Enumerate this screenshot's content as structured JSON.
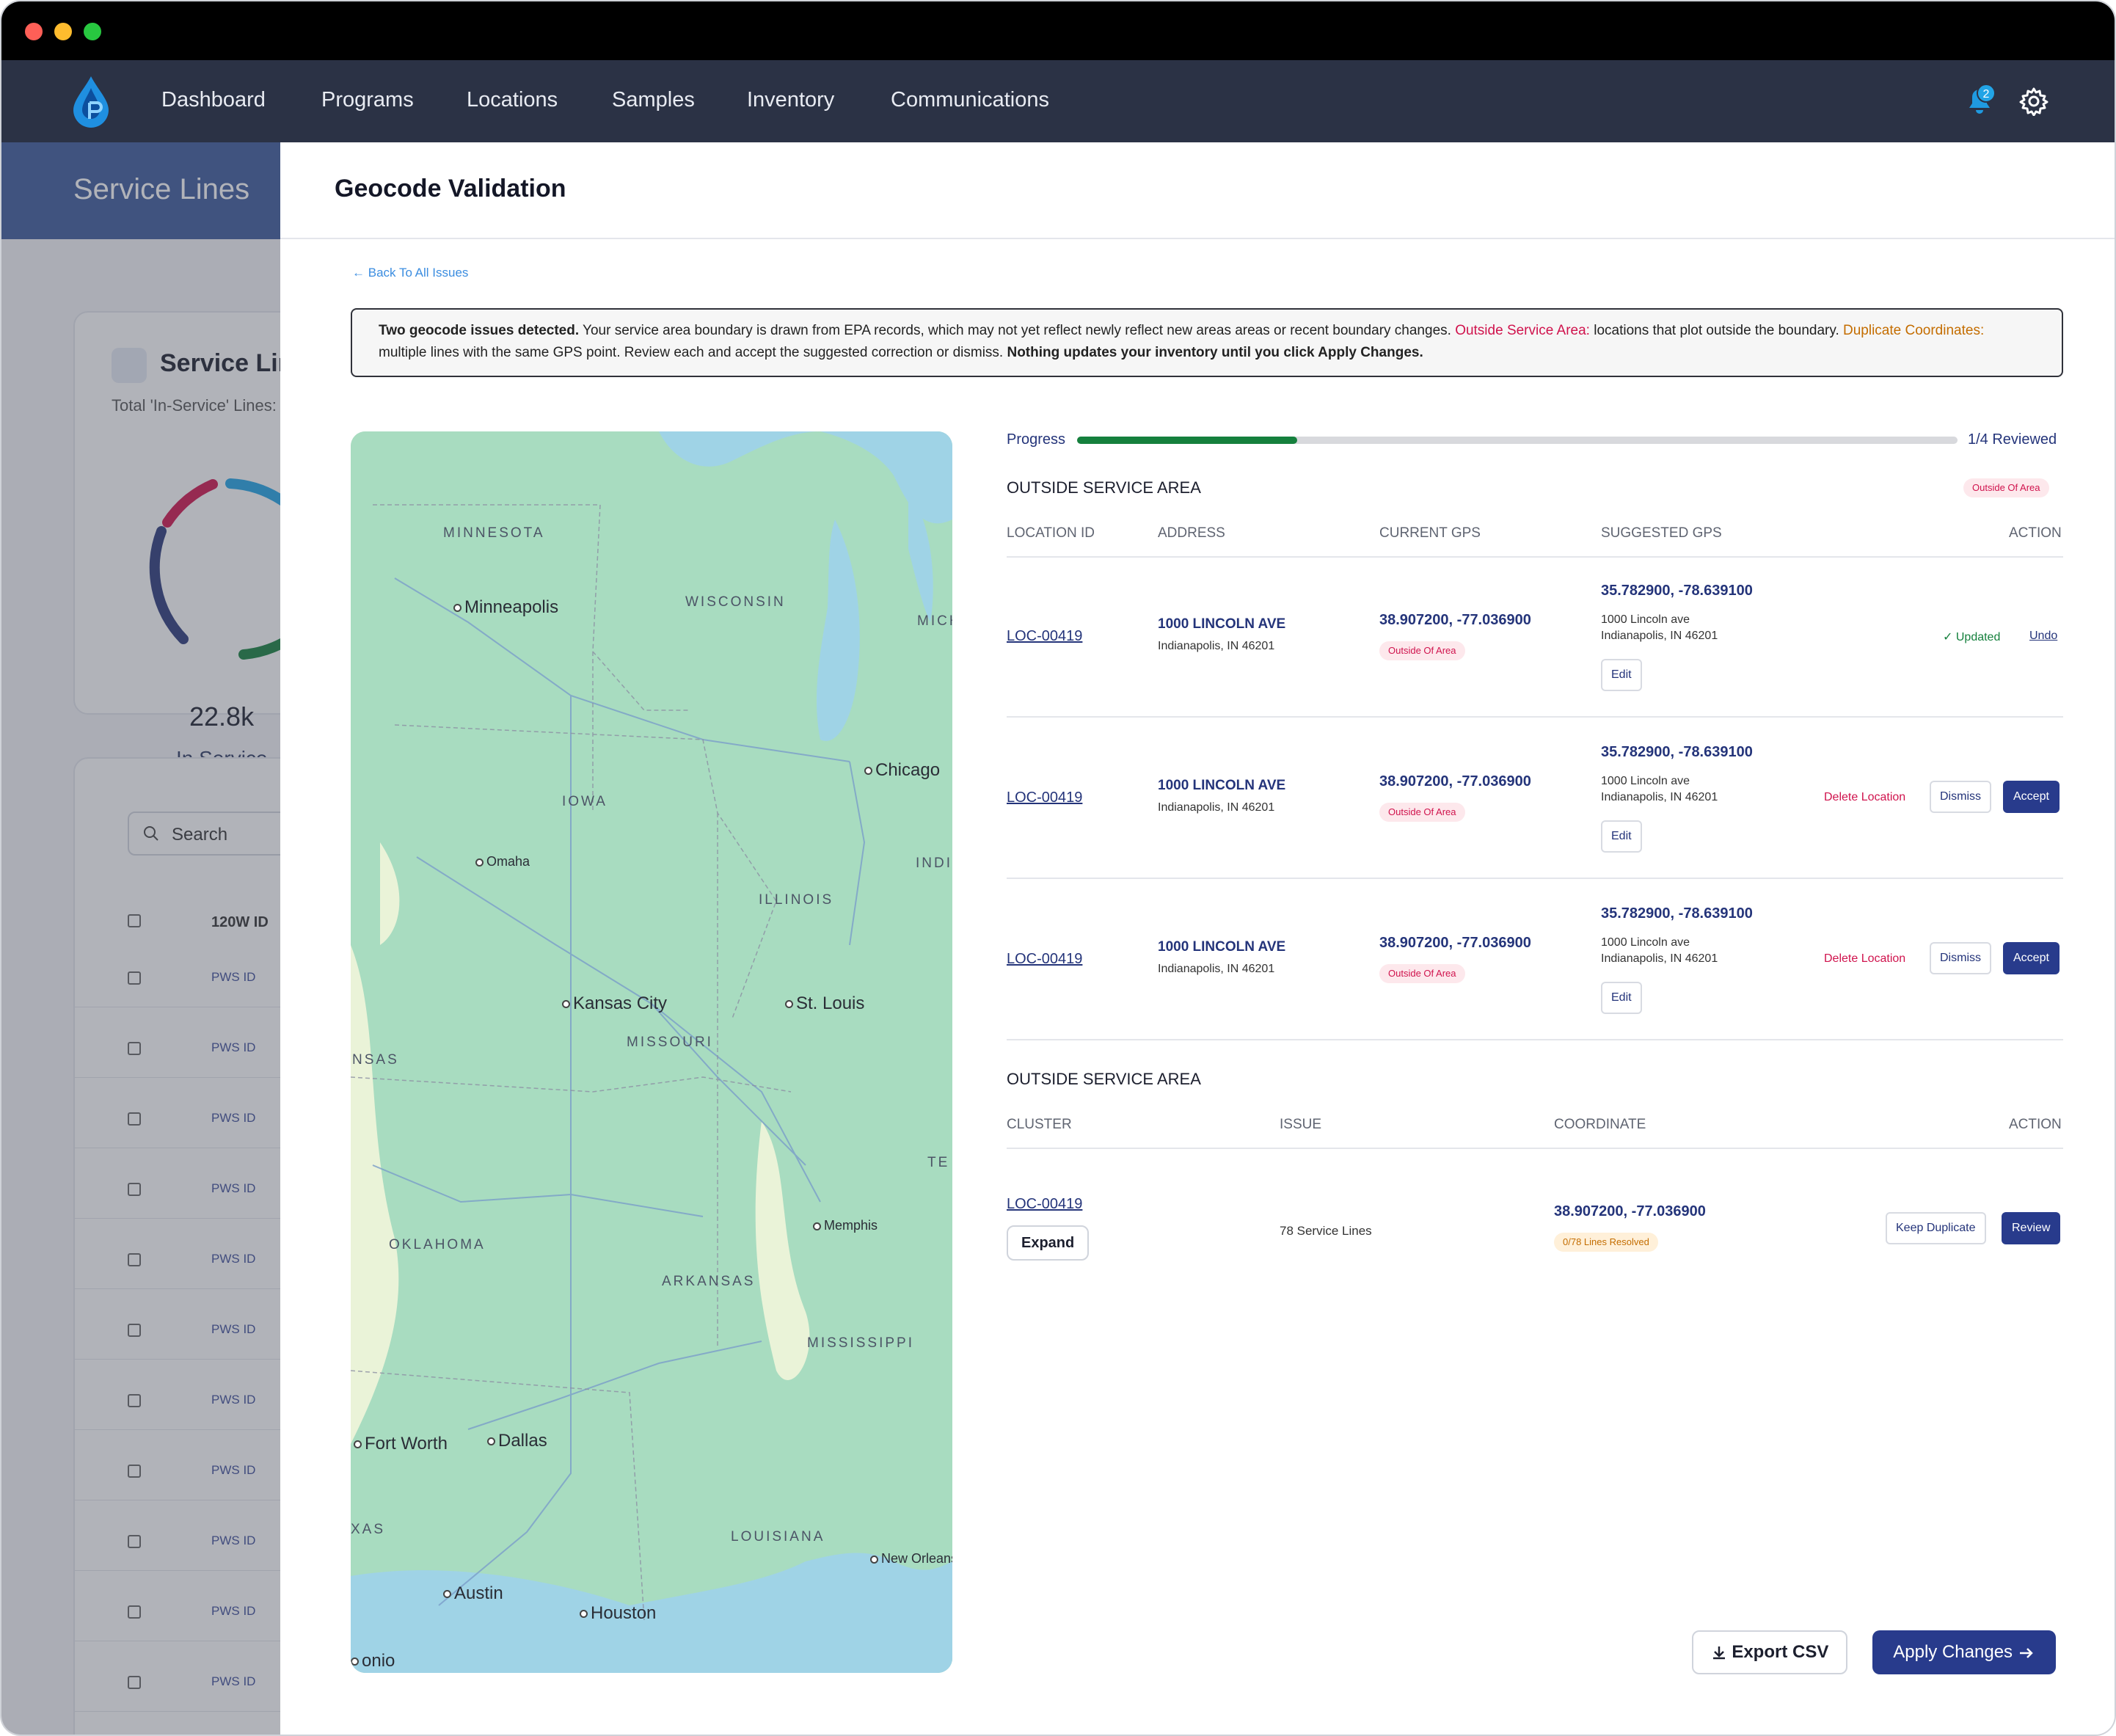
{
  "nav": {
    "items": [
      "Dashboard",
      "Programs",
      "Locations",
      "Samples",
      "Inventory",
      "Communications"
    ],
    "notification_count": "2",
    "icons": [
      "bell-icon",
      "gear-icon"
    ]
  },
  "background": {
    "header_title": "Service Lines",
    "card_title": "Service Lin",
    "card_subtitle": "Total 'In-Service' Lines:",
    "donut_value": "22.8k",
    "donut_label": "In Service",
    "search_placeholder": "Search",
    "column_header": "120W ID",
    "row_label": "PWS ID",
    "row_count": 11
  },
  "page": {
    "title": "Geocode Validation",
    "back_link": "Back To All Issues"
  },
  "alert": {
    "lead": "Two geocode issues detected.",
    "text1": " Your service area boundary is drawn from EPA records, which may not yet reflect newly reflect new areas areas or recent boundary changes. ",
    "outside_label": "Outside Service Area:",
    "text2": " locations that plot outside the boundary. ",
    "duplicate_label": "Duplicate Coordinates:",
    "text3": " multiple lines with the same GPS point. Review each and accept the suggested correction or dismiss. ",
    "trailer": "Nothing updates your inventory until you click Apply Changes."
  },
  "map": {
    "labels": {
      "states": [
        "MINNESOTA",
        "WISCONSIN",
        "MICH",
        "IOWA",
        "ILLINOIS",
        "INDIA",
        "MISSOURI",
        "NSAS",
        "OKLAHOMA",
        "ARKANSAS",
        "MISSISSIPPI",
        "TE",
        "LOUISIANA",
        "XAS"
      ],
      "cities": [
        "Minneapolis",
        "Chicago",
        "Omaha",
        "Kansas City",
        "St. Louis",
        "Memphis",
        "Fort Worth",
        "Dallas",
        "Austin",
        "Houston",
        "New Orleans",
        "onio"
      ]
    }
  },
  "progress": {
    "label": "Progress",
    "reviewed": 1,
    "total": 4,
    "count_text": "1/4 Reviewed"
  },
  "outside_section": {
    "title": "OUTSIDE SERVICE AREA",
    "chip": "Outside Of Area",
    "columns": [
      "LOCATION ID",
      "ADDRESS",
      "CURRENT GPS",
      "SUGGESTED GPS",
      "ACTION"
    ],
    "rows": [
      {
        "id": "LOC-00419",
        "address_line1": "1000 LINCOLN AVE",
        "address_line2": "Indianapolis, IN 46201",
        "current_gps": "38.907200, -77.036900",
        "current_chip": "Outside Of Area",
        "suggested_gps": "35.782900, -78.639100",
        "suggested_line1": "1000 Lincoln ave",
        "suggested_line2": "Indianapolis, IN 46201",
        "edit": "Edit",
        "status": "Updated",
        "undo": "Undo"
      },
      {
        "id": "LOC-00419",
        "address_line1": "1000 LINCOLN AVE",
        "address_line2": "Indianapolis, IN 46201",
        "current_gps": "38.907200, -77.036900",
        "current_chip": "Outside Of Area",
        "suggested_gps": "35.782900, -78.639100",
        "suggested_line1": "1000 Lincoln ave",
        "suggested_line2": "Indianapolis, IN 46201",
        "edit": "Edit",
        "delete": "Delete Location",
        "dismiss": "Dismiss",
        "accept": "Accept"
      },
      {
        "id": "LOC-00419",
        "address_line1": "1000 LINCOLN AVE",
        "address_line2": "Indianapolis, IN 46201",
        "current_gps": "38.907200, -77.036900",
        "current_chip": "Outside Of Area",
        "suggested_gps": "35.782900, -78.639100",
        "suggested_line1": "1000 Lincoln ave",
        "suggested_line2": "Indianapolis, IN 46201",
        "edit": "Edit",
        "delete": "Delete Location",
        "dismiss": "Dismiss",
        "accept": "Accept"
      }
    ]
  },
  "duplicate_section": {
    "title": "OUTSIDE SERVICE AREA",
    "columns": [
      "CLUSTER",
      "ISSUE",
      "COORDINATE",
      "ACTION"
    ],
    "row": {
      "cluster": "LOC-00419",
      "expand": "Expand",
      "issue": "78 Service Lines",
      "coordinate": "38.907200, -77.036900",
      "chip": "0/78 Lines Resolved",
      "keep": "Keep Duplicate",
      "review": "Review"
    }
  },
  "footer": {
    "export": "Export CSV",
    "apply": "Apply Changes"
  },
  "colors": {
    "navbar": "#2b3245",
    "primary": "#283b8c",
    "accent_red": "#d0134d",
    "accent_orange": "#c46d00",
    "success": "#15803d"
  }
}
